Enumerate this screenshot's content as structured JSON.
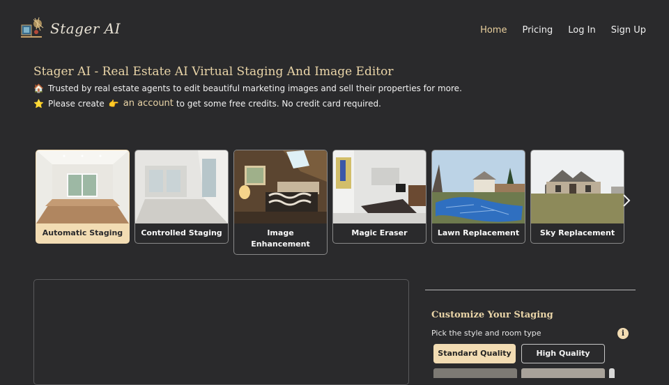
{
  "brand": {
    "name": "Stager AI"
  },
  "nav": {
    "items": [
      {
        "label": "Home",
        "active": true
      },
      {
        "label": "Pricing",
        "active": false
      },
      {
        "label": "Log In",
        "active": false
      },
      {
        "label": "Sign Up",
        "active": false
      }
    ]
  },
  "hero": {
    "title": "Stager AI - Real Estate AI Virtual Staging And Image Editor",
    "line1": "Trusted by real estate agents to edit beautiful marketing images and sell their properties for more.",
    "line2_prefix": "Please create",
    "line2_link": "an account",
    "line2_suffix": "to get some free credits. No credit card required."
  },
  "tools": [
    {
      "label": "Automatic Staging",
      "active": true
    },
    {
      "label": "Controlled Staging",
      "active": false
    },
    {
      "label": "Image Enhancement",
      "active": false
    },
    {
      "label": "Magic Eraser",
      "active": false
    },
    {
      "label": "Lawn Replacement",
      "active": false
    },
    {
      "label": "Sky Replacement",
      "active": false
    }
  ],
  "customize": {
    "title": "Customize Your Staging",
    "subtitle": "Pick the style and room type",
    "quality_options": [
      "Standard Quality",
      "High Quality"
    ],
    "selected_quality": "Standard Quality"
  },
  "colors": {
    "background": "#2a2a2c",
    "accent": "#f2dcb3",
    "gold_text": "#ead5a8"
  },
  "icons": {
    "house": "house-emoji-icon",
    "star": "star-emoji-icon",
    "pointing": "pointing-hand-icon",
    "info": "info-icon",
    "next": "chevron-right-icon"
  }
}
